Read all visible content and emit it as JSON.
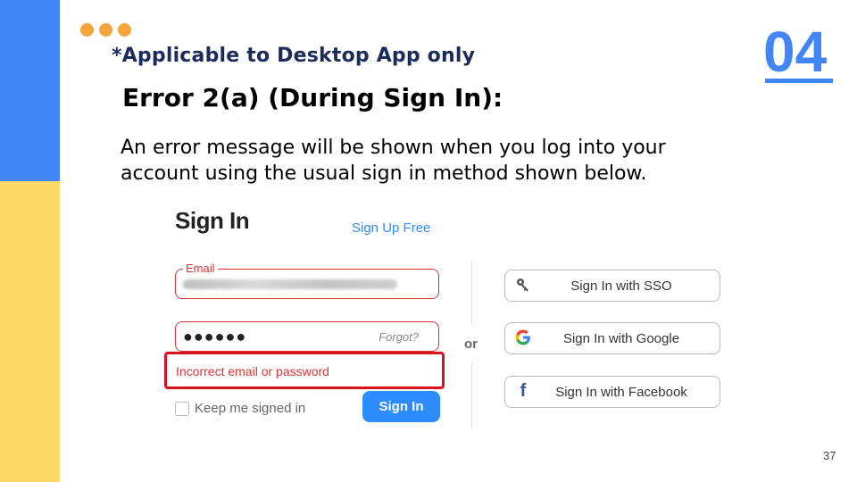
{
  "slide": {
    "note": "*Applicable to Desktop App only",
    "number": "04",
    "heading": "Error 2(a) (During Sign In):",
    "description": "An error message will be shown when you log into your account using the usual sign in method shown below.",
    "page_number": "37"
  },
  "colors": {
    "accent_blue": "#4285f4",
    "accent_yellow": "#ffd966",
    "dot_orange": "#f6a53a",
    "error_red": "#d9131f",
    "zoom_blue": "#2d8cff"
  },
  "signin": {
    "title": "Sign In",
    "signup_link": "Sign Up Free",
    "email_label": "Email",
    "password_mask": "●●●●●●",
    "forgot_link": "Forgot?",
    "error_message": "Incorrect email or password",
    "keep_signed_in": "Keep me signed in",
    "signin_button": "Sign In",
    "or_label": "or",
    "sso_button": "Sign In with SSO",
    "google_button": "Sign In with Google",
    "facebook_button": "Sign In with Facebook",
    "icons": {
      "sso": "key-icon",
      "google": "google-icon",
      "facebook": "facebook-icon"
    }
  }
}
